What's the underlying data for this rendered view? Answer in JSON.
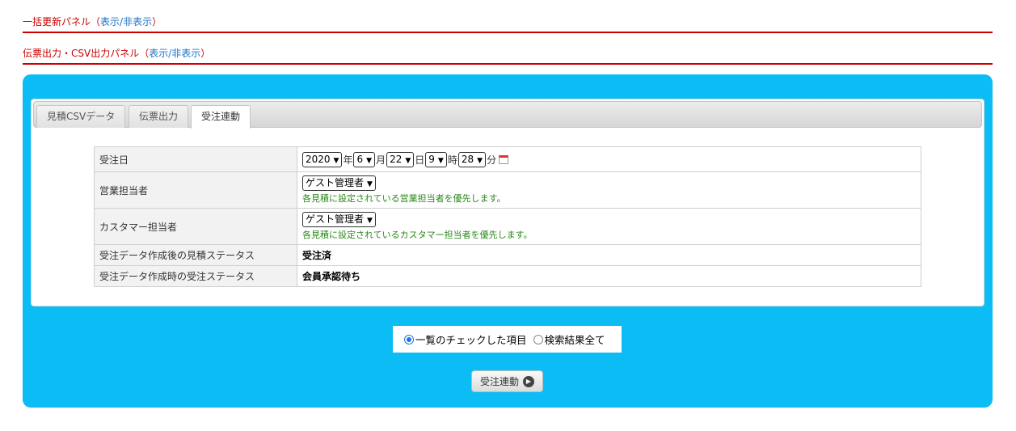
{
  "panels": {
    "bulk_update": {
      "title": "一括更新パネル",
      "paren_open": "（",
      "toggle": "表示/非表示",
      "paren_close": "）"
    },
    "slip_csv": {
      "title": "伝票出力・CSV出力パネル",
      "paren_open": "（",
      "toggle": "表示/非表示",
      "paren_close": "）"
    }
  },
  "tabs": [
    {
      "label": "見積CSVデータ"
    },
    {
      "label": "伝票出力"
    },
    {
      "label": "受注連動",
      "active": true
    }
  ],
  "form": {
    "order_date": {
      "label": "受注日",
      "year": "2020",
      "year_unit": "年",
      "month": "6",
      "month_unit": "月",
      "day": "22",
      "day_unit": "日",
      "hour": "9",
      "hour_unit": "時",
      "minute": "28",
      "minute_unit": "分",
      "icon": "calendar-icon"
    },
    "sales_rep": {
      "label": "営業担当者",
      "selected": "ゲスト管理者",
      "note": "各見積に設定されている営業担当者を優先します。"
    },
    "customer_rep": {
      "label": "カスタマー担当者",
      "selected": "ゲスト管理者",
      "note": "各見積に設定されているカスタマー担当者を優先します。"
    },
    "quote_status_after": {
      "label": "受注データ作成後の見積ステータス",
      "value": "受注済"
    },
    "order_status_on_create": {
      "label": "受注データ作成時の受注ステータス",
      "value": "会員承認待ち"
    }
  },
  "scope": {
    "options": [
      {
        "label": "一覧のチェックした項目",
        "selected": true
      },
      {
        "label": "検索結果全て",
        "selected": false
      }
    ]
  },
  "submit": {
    "label": "受注連動",
    "icon": "arrow-right-circle-icon"
  },
  "colors": {
    "panel_bg": "#0bbcf5",
    "heading_red": "#cc0000",
    "link_blue": "#1a73c6",
    "note_green": "#2a8a1a"
  }
}
